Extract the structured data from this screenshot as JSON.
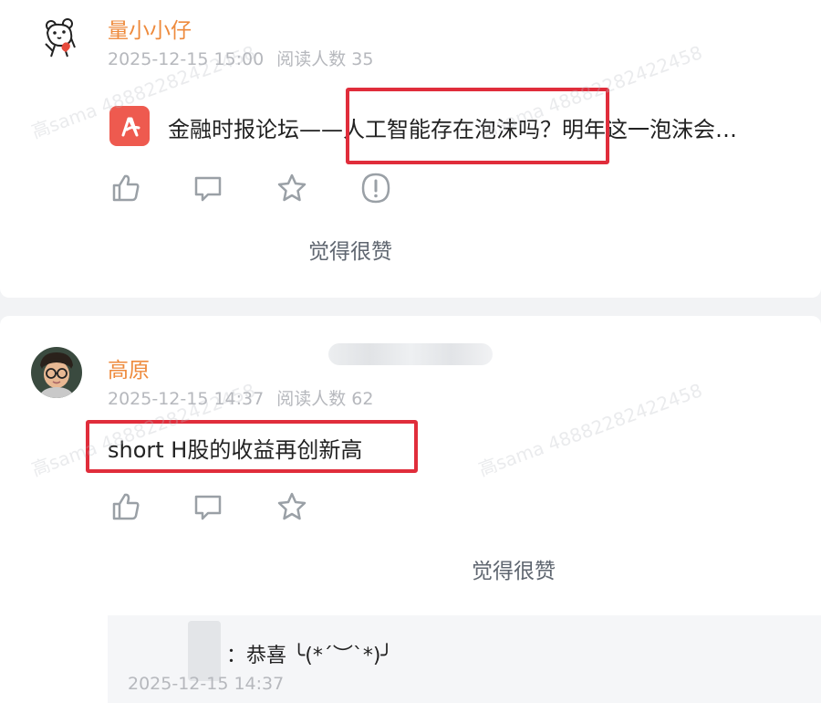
{
  "posts": [
    {
      "author": "量小小仔",
      "date": "2025-12-15 15:00",
      "reads": "阅读人数 35",
      "attachment_title": "金融时报论坛——人工智能存在泡沫吗？明年这一泡沫会…",
      "liked_label": "觉得很赞"
    },
    {
      "author": "高原",
      "date": "2025-12-15 14:37",
      "reads": "阅读人数 62",
      "text": "short H股的收益再创新高",
      "liked_label": "觉得很赞",
      "reply": {
        "text": "：恭喜 ╰(*´︶`*)╯",
        "date": "2025-12-15 14:37"
      }
    }
  ],
  "watermark": "高sama 48882282422458",
  "colors": {
    "author": "#ee8a3c",
    "meta": "#b6b8bd",
    "highlight": "#e02d3b",
    "pdf": "#ee5a4f"
  },
  "icons": [
    "like-icon",
    "comment-icon",
    "star-icon",
    "report-icon",
    "pdf-icon"
  ]
}
